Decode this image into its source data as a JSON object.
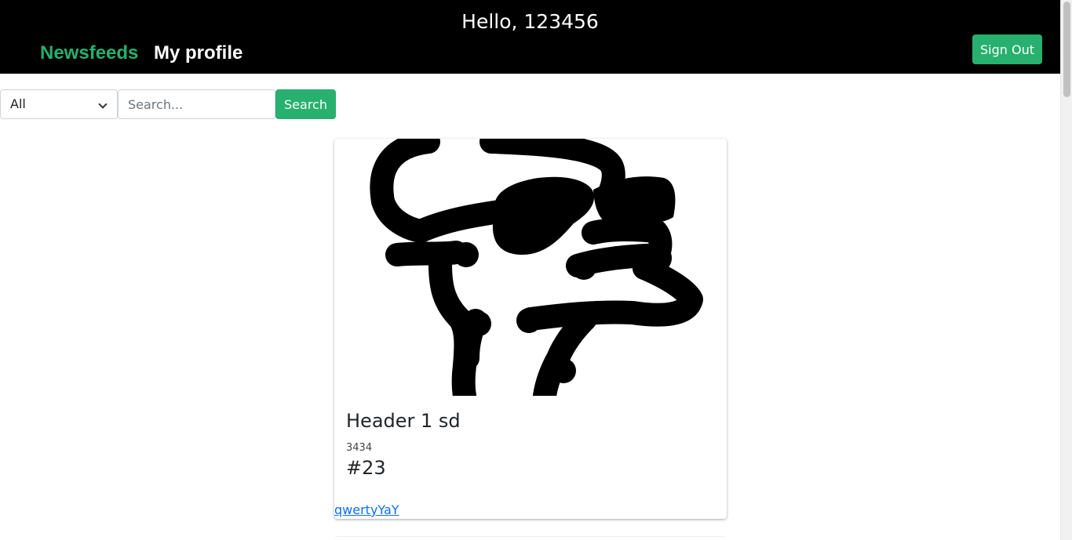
{
  "header": {
    "greeting": "Hello, 123456",
    "nav": {
      "newsfeeds": "Newsfeeds",
      "my_profile": "My profile"
    },
    "sign_out_label": "Sign Out"
  },
  "filter": {
    "selected": "All",
    "search_placeholder": "Search...",
    "search_value": "",
    "search_button_label": "Search"
  },
  "post": {
    "title": "Header 1 sd",
    "meta": "3434",
    "tag": "#23",
    "author": "qwertyYaY"
  },
  "colors": {
    "accent": "#27b06e",
    "header_bg": "#000000",
    "link": "#0d6efd"
  }
}
